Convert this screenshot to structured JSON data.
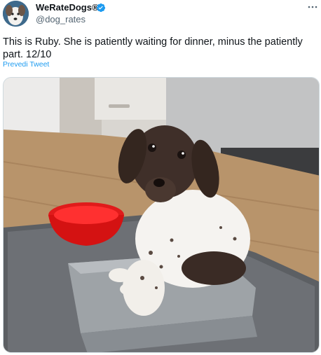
{
  "account": {
    "display_name": "WeRateDogs®",
    "handle": "@dog_rates",
    "verified": true,
    "avatar_icon": "dog-face-avatar"
  },
  "tweet": {
    "text": "This is Ruby. She is patiently waiting for dinner, minus the patiently part. 12/10",
    "translate_label": "Prevedi Tweet"
  },
  "media": {
    "subject": "puppy sitting in a grey food bowl beside a red bowl"
  },
  "colors": {
    "accent": "#1d9bf0",
    "text": "#0f1419",
    "secondary_text": "#536471"
  },
  "icons": {
    "more": "more-icon",
    "verified": "verified-badge-icon"
  }
}
